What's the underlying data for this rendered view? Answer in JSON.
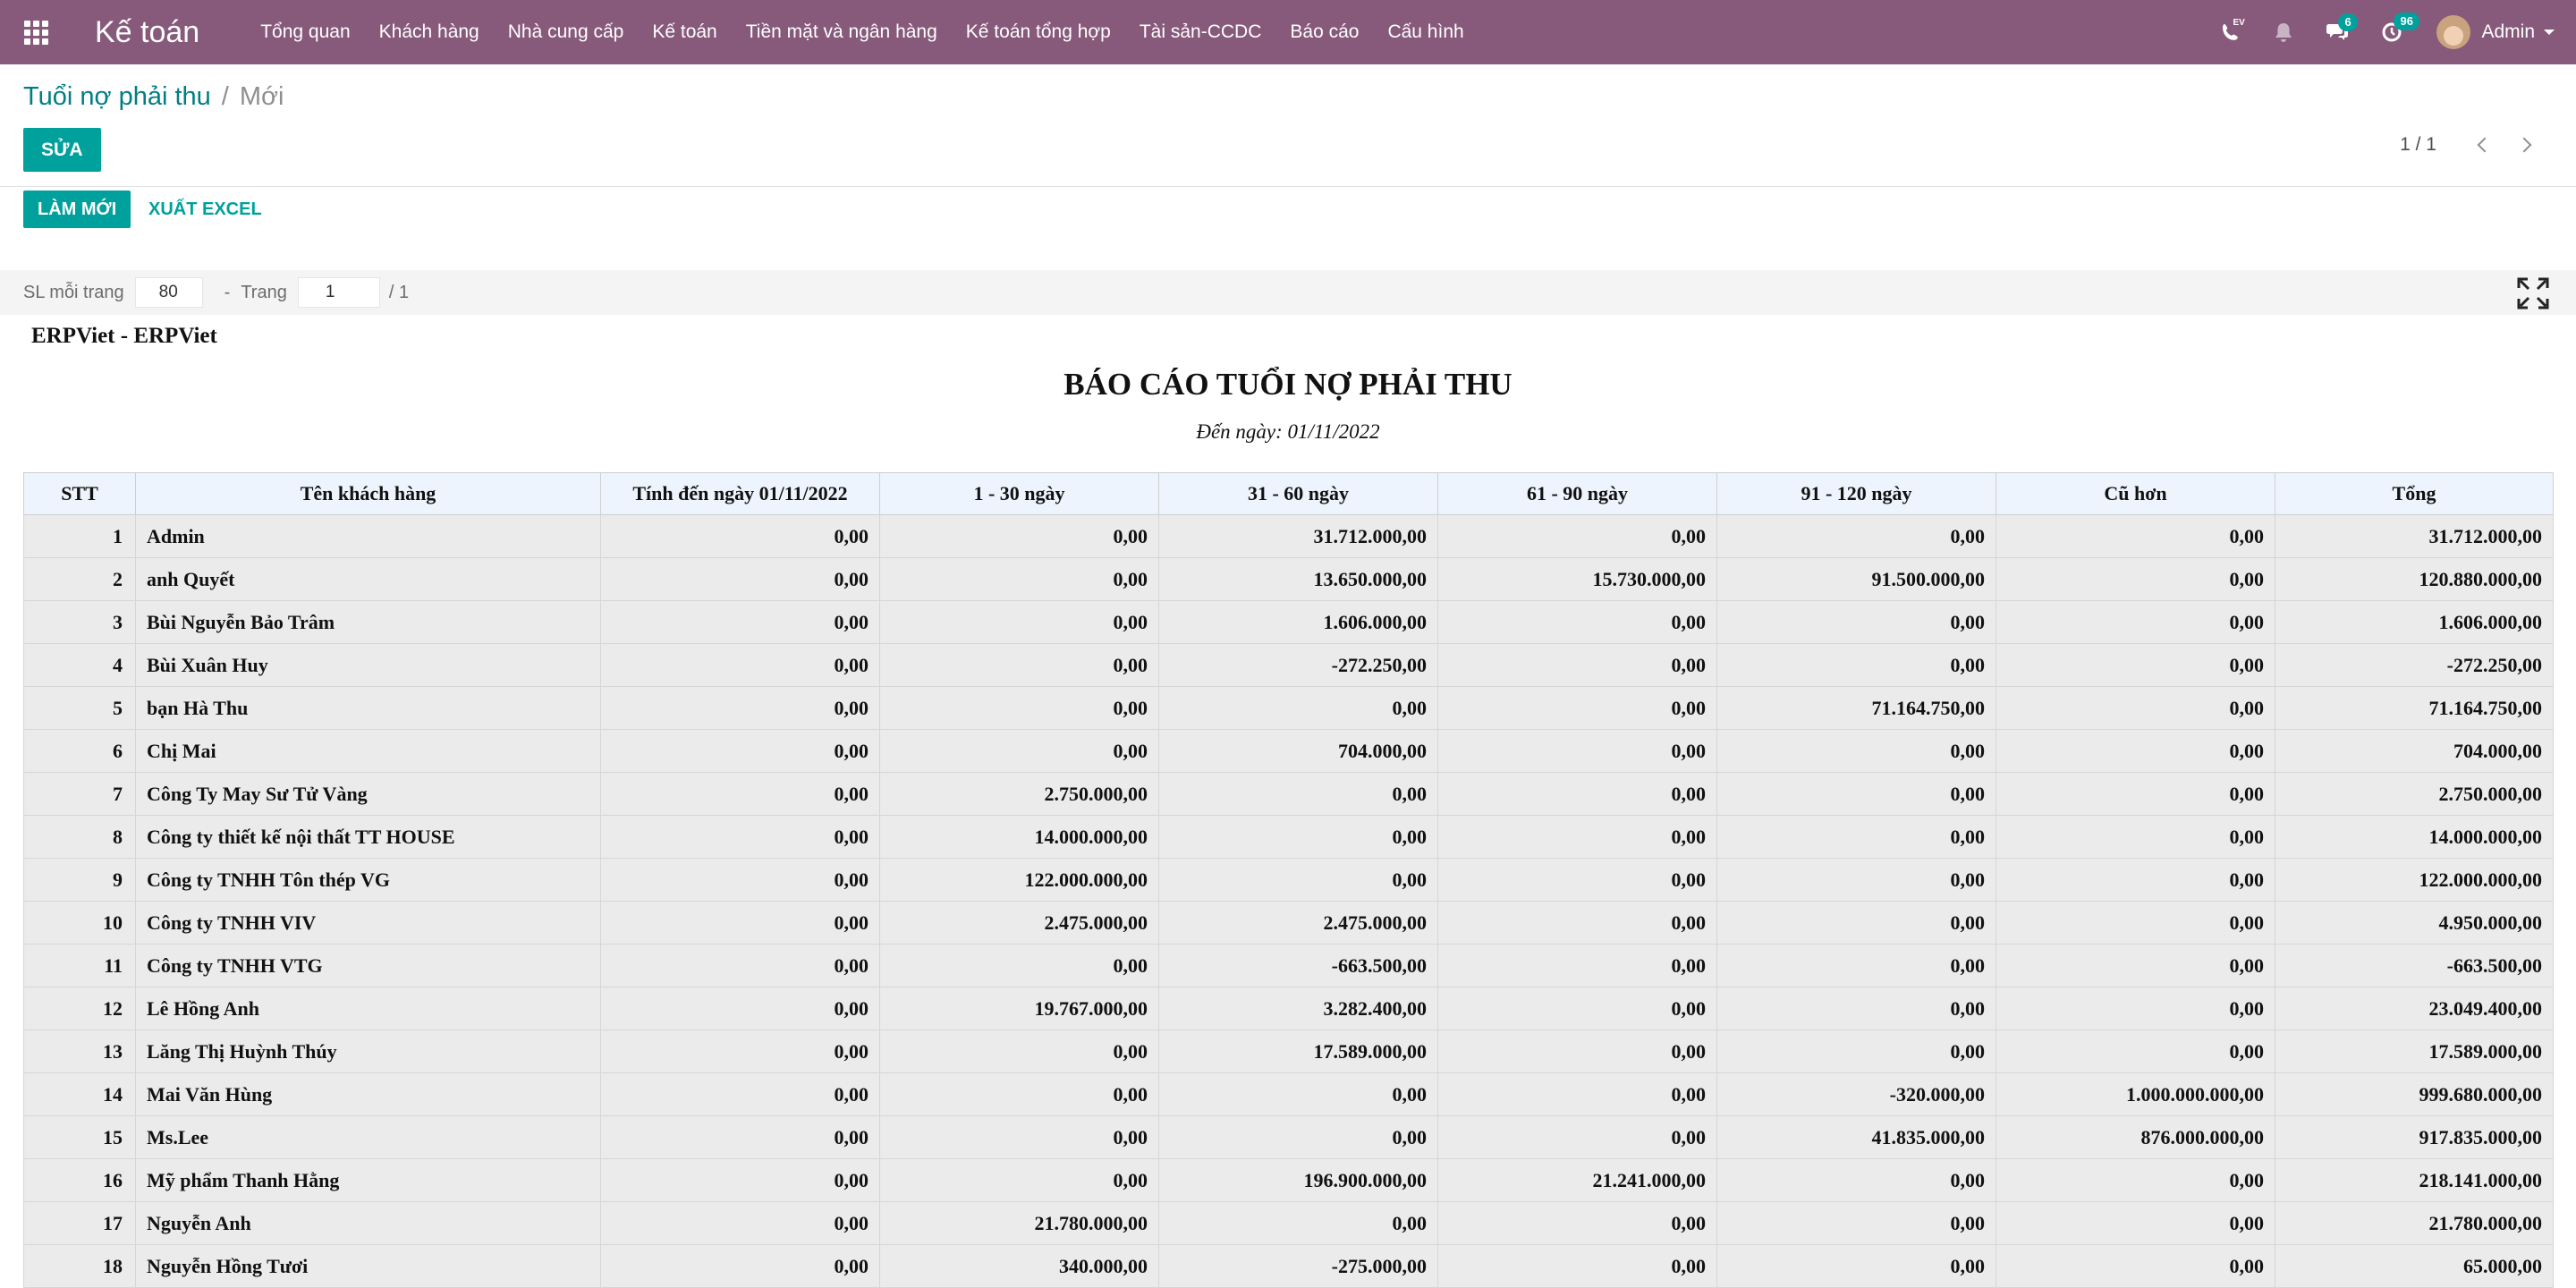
{
  "navbar": {
    "brand": "Kế toán",
    "menu": [
      "Tổng quan",
      "Khách hàng",
      "Nhà cung cấp",
      "Kế toán",
      "Tiền mặt và ngân hàng",
      "Kế toán tổng hợp",
      "Tài sản-CCDC",
      "Báo cáo",
      "Cấu hình"
    ],
    "phone_badge": "EV",
    "messages_count": "6",
    "activities_count": "96",
    "user": "Admin"
  },
  "breadcrumb": {
    "parent": "Tuổi nợ phải thu",
    "separator": "/",
    "current": "Mới"
  },
  "toolbar": {
    "edit_label": "SỬA",
    "pager": "1 / 1"
  },
  "actions": {
    "refresh_label": "LÀM MỚI",
    "export_label": "XUẤT EXCEL"
  },
  "pagination": {
    "per_page_label": "SL mỗi trang",
    "per_page_value": "80",
    "dash": "-",
    "page_label": "Trang",
    "page_value": "1",
    "total_pages": "/ 1"
  },
  "report": {
    "company": "ERPViet - ERPViet",
    "title": "BÁO CÁO TUỔI NỢ PHẢI THU",
    "date_line": "Đến ngày: 01/11/2022",
    "columns": [
      "STT",
      "Tên khách hàng",
      "Tính đến ngày 01/11/2022",
      "1 - 30 ngày",
      "31 - 60 ngày",
      "61 - 90 ngày",
      "91 - 120 ngày",
      "Cũ hơn",
      "Tổng"
    ],
    "rows": [
      [
        "1",
        "Admin",
        "0,00",
        "0,00",
        "31.712.000,00",
        "0,00",
        "0,00",
        "0,00",
        "31.712.000,00"
      ],
      [
        "2",
        "anh Quyết",
        "0,00",
        "0,00",
        "13.650.000,00",
        "15.730.000,00",
        "91.500.000,00",
        "0,00",
        "120.880.000,00"
      ],
      [
        "3",
        "Bùi Nguyễn Bảo Trâm",
        "0,00",
        "0,00",
        "1.606.000,00",
        "0,00",
        "0,00",
        "0,00",
        "1.606.000,00"
      ],
      [
        "4",
        "Bùi Xuân Huy",
        "0,00",
        "0,00",
        "-272.250,00",
        "0,00",
        "0,00",
        "0,00",
        "-272.250,00"
      ],
      [
        "5",
        "bạn Hà Thu",
        "0,00",
        "0,00",
        "0,00",
        "0,00",
        "71.164.750,00",
        "0,00",
        "71.164.750,00"
      ],
      [
        "6",
        "Chị Mai",
        "0,00",
        "0,00",
        "704.000,00",
        "0,00",
        "0,00",
        "0,00",
        "704.000,00"
      ],
      [
        "7",
        "Công Ty May Sư Tử Vàng",
        "0,00",
        "2.750.000,00",
        "0,00",
        "0,00",
        "0,00",
        "0,00",
        "2.750.000,00"
      ],
      [
        "8",
        "Công ty thiết kế nội thất TT HOUSE",
        "0,00",
        "14.000.000,00",
        "0,00",
        "0,00",
        "0,00",
        "0,00",
        "14.000.000,00"
      ],
      [
        "9",
        "Công ty TNHH Tôn thép VG",
        "0,00",
        "122.000.000,00",
        "0,00",
        "0,00",
        "0,00",
        "0,00",
        "122.000.000,00"
      ],
      [
        "10",
        "Công ty TNHH VIV",
        "0,00",
        "2.475.000,00",
        "2.475.000,00",
        "0,00",
        "0,00",
        "0,00",
        "4.950.000,00"
      ],
      [
        "11",
        "Công ty TNHH VTG",
        "0,00",
        "0,00",
        "-663.500,00",
        "0,00",
        "0,00",
        "0,00",
        "-663.500,00"
      ],
      [
        "12",
        "Lê Hồng Anh",
        "0,00",
        "19.767.000,00",
        "3.282.400,00",
        "0,00",
        "0,00",
        "0,00",
        "23.049.400,00"
      ],
      [
        "13",
        "Lăng Thị Huỳnh Thúy",
        "0,00",
        "0,00",
        "17.589.000,00",
        "0,00",
        "0,00",
        "0,00",
        "17.589.000,00"
      ],
      [
        "14",
        "Mai Văn Hùng",
        "0,00",
        "0,00",
        "0,00",
        "0,00",
        "-320.000,00",
        "1.000.000.000,00",
        "999.680.000,00"
      ],
      [
        "15",
        "Ms.Lee",
        "0,00",
        "0,00",
        "0,00",
        "0,00",
        "41.835.000,00",
        "876.000.000,00",
        "917.835.000,00"
      ],
      [
        "16",
        "Mỹ phẩm Thanh Hằng",
        "0,00",
        "0,00",
        "196.900.000,00",
        "21.241.000,00",
        "0,00",
        "0,00",
        "218.141.000,00"
      ],
      [
        "17",
        "Nguyễn Anh",
        "0,00",
        "21.780.000,00",
        "0,00",
        "0,00",
        "0,00",
        "0,00",
        "21.780.000,00"
      ],
      [
        "18",
        "Nguyễn Hồng Tươi",
        "0,00",
        "340.000,00",
        "-275.000,00",
        "0,00",
        "0,00",
        "0,00",
        "65.000,00"
      ]
    ]
  },
  "colors": {
    "navbar": "#875a7b",
    "primary": "#00a09d",
    "link": "#017e84",
    "header_bg": "#eef4fd",
    "row_bg": "#ebebeb"
  }
}
